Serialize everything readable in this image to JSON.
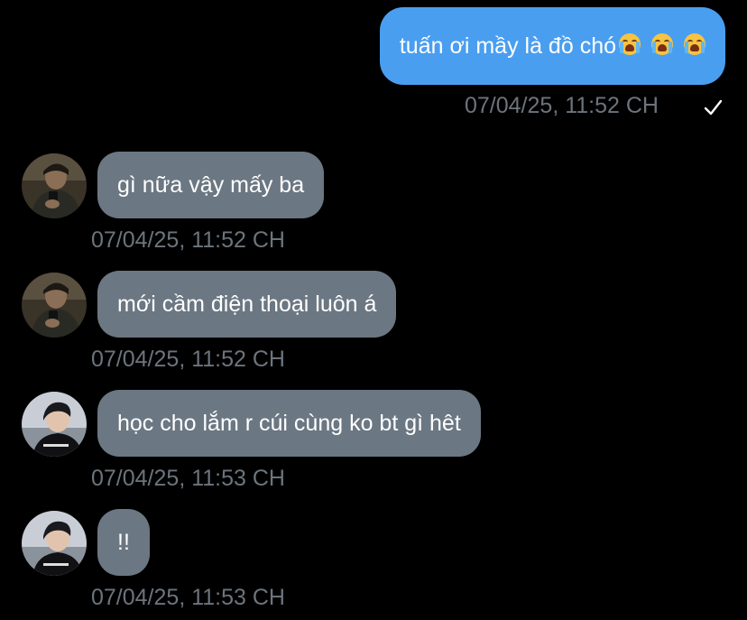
{
  "messages": [
    {
      "direction": "outgoing",
      "text": "tuấn ơi mầy là đồ chó",
      "emojis": [
        "loudly-crying-face-emoji",
        "loudly-crying-face-emoji",
        "loudly-crying-face-emoji"
      ],
      "timestamp": "07/04/25, 11:52 CH",
      "status_icon": "sent-check-icon"
    },
    {
      "direction": "incoming",
      "avatar": "avatar-user-a",
      "text": "gì nữa vậy mấy ba",
      "timestamp": "07/04/25, 11:52 CH"
    },
    {
      "direction": "incoming",
      "avatar": "avatar-user-a",
      "text": "mới cầm điện thoại luôn á",
      "timestamp": "07/04/25, 11:52 CH"
    },
    {
      "direction": "incoming",
      "avatar": "avatar-user-b",
      "text": "học cho lắm r cúi cùng ko bt gì hêt",
      "timestamp": "07/04/25, 11:53 CH"
    },
    {
      "direction": "incoming",
      "avatar": "avatar-user-b",
      "text": "!!",
      "timestamp": "07/04/25, 11:53 CH"
    }
  ],
  "colors": {
    "background": "#000000",
    "outgoing_bubble": "#4a9ef0",
    "incoming_bubble": "#6b7782",
    "timestamp": "#6c747c"
  }
}
